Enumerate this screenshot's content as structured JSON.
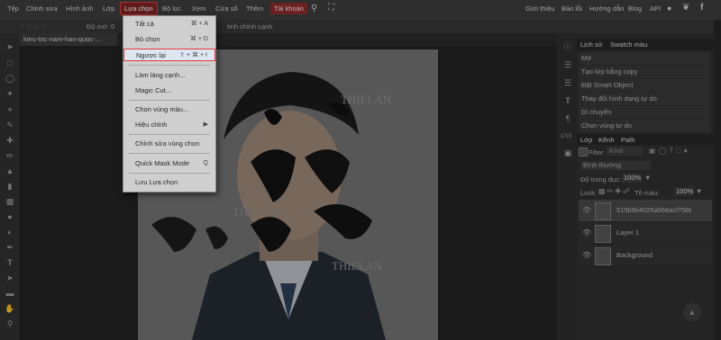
{
  "menubar": {
    "items": [
      "Tệp",
      "Chỉnh sửa",
      "Hình ảnh",
      "Lớp",
      "Lựa chọn",
      "Bộ lọc",
      "Xem",
      "Cửa sổ",
      "Thêm"
    ],
    "active": "Lựa chọn",
    "account": "Tài khoản",
    "right_links": [
      "Giới thiệu",
      "Báo lỗi",
      "Hướng dẫn",
      "Blog",
      "API"
    ]
  },
  "options_bar": {
    "feather_label": "Độ mờ: 0",
    "refine_edge": "tinh chỉnh cạnh"
  },
  "document": {
    "tab_label": "kieu-toc-nam-han-quoc-..."
  },
  "selection_menu": {
    "items": [
      {
        "label": "Tất cả",
        "shortcut": "⌘ + A"
      },
      {
        "label": "Bỏ chọn",
        "shortcut": "⌘ + D"
      },
      {
        "label": "Ngược lại",
        "shortcut": "⇧ + ⌘ + I",
        "highlighted": true
      },
      {
        "label": "Làm láng cạnh...",
        "shortcut": ""
      },
      {
        "label": "Magic Cut...",
        "shortcut": ""
      },
      {
        "label": "Chọn vùng màu...",
        "shortcut": ""
      },
      {
        "label": "Hiệu chỉnh",
        "shortcut": "▶"
      },
      {
        "label": "Chỉnh sửa vùng chọn",
        "shortcut": ""
      },
      {
        "label": "Quick Mask Mode",
        "shortcut": "Q"
      },
      {
        "label": "Lưu Lựa chọn",
        "shortcut": ""
      }
    ]
  },
  "history_panel": {
    "tabs": [
      "Lịch sử",
      "Swatch màu"
    ],
    "items": [
      "Mở",
      "Tạo lớp bằng copy",
      "Đặt Smart Object",
      "Thay đổi hình dạng tự do",
      "Di chuyển",
      "Chọn vùng tự do"
    ]
  },
  "layers_panel": {
    "tabs": [
      "Lớp",
      "Kênh",
      "Path"
    ],
    "filter_label": "Filter",
    "filter_kind": "Kind",
    "blend_mode": "Bình thường",
    "opacity_label": "Độ trong đục:",
    "opacity_value": "100%",
    "lock_label": "Lock:",
    "fill_label": "Tô màu:",
    "fill_value": "100%",
    "layers": [
      "515b9b4025a066acf756t",
      "Layer 1",
      "Background"
    ]
  },
  "watermark": "THIELAN"
}
